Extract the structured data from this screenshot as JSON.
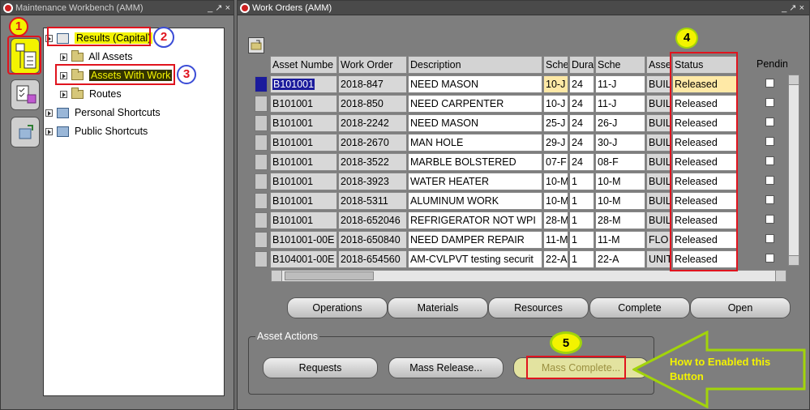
{
  "left_window": {
    "title": "Maintenance Workbench (AMM)",
    "controls": "_ ↗ ×"
  },
  "right_window": {
    "title": "Work Orders (AMM)",
    "controls": "_ ↗ ×"
  },
  "tree": {
    "results": "Results (Capital)",
    "all_assets": "All Assets",
    "assets_with_work": "Assets With Work",
    "routes": "Routes",
    "personal_shortcuts": "Personal Shortcuts",
    "public_shortcuts": "Public Shortcuts"
  },
  "grid": {
    "headers": [
      "Asset Numbe",
      "Work Order",
      "Description",
      "Sche",
      "Dura",
      "Sche",
      "Asse",
      "Status",
      "Pendin"
    ],
    "rows": [
      [
        "B101001",
        "2018-847",
        "NEED MASON",
        "10-J",
        "24",
        "11-J",
        "BUIL",
        "Released"
      ],
      [
        "B101001",
        "2018-850",
        "NEED CARPENTER",
        "10-J",
        "24",
        "11-J",
        "BUIL",
        "Released"
      ],
      [
        "B101001",
        "2018-2242",
        "NEED MASON",
        "25-J",
        "24",
        "26-J",
        "BUIL",
        "Released"
      ],
      [
        "B101001",
        "2018-2670",
        "MAN HOLE",
        "29-J",
        "24",
        "30-J",
        "BUIL",
        "Released"
      ],
      [
        "B101001",
        "2018-3522",
        "MARBLE BOLSTERED",
        "07-F",
        "24",
        "08-F",
        "BUIL",
        "Released"
      ],
      [
        "B101001",
        "2018-3923",
        "WATER HEATER",
        "10-M",
        "1",
        "10-M",
        "BUIL",
        "Released"
      ],
      [
        "B101001",
        "2018-5311",
        "ALUMINUM WORK",
        "10-M",
        "1",
        "10-M",
        "BUIL",
        "Released"
      ],
      [
        "B101001",
        "2018-652046",
        "REFRIGERATOR NOT WPI",
        "28-M",
        "1",
        "28-M",
        "BUIL",
        "Released"
      ],
      [
        "B101001-00E",
        "2018-650840",
        "NEED DAMPER REPAIR",
        "11-M",
        "1",
        "11-M",
        "FLO",
        "Released"
      ],
      [
        "B104001-00E",
        "2018-654560",
        "AM-CVLPVT testing securit",
        "22-A",
        "1",
        "22-A",
        "UNIT",
        "Released"
      ]
    ]
  },
  "tab_buttons": {
    "operations": "Operations",
    "materials": "Materials",
    "resources": "Resources",
    "complete": "Complete",
    "open": "Open"
  },
  "asset_actions": {
    "label": "Asset Actions",
    "requests": "Requests",
    "mass_release": "Mass Release...",
    "mass_complete": "Mass Complete..."
  },
  "annotations": {
    "b1": "1",
    "b2": "2",
    "b3": "3",
    "b4": "4",
    "b5": "5",
    "callout": "How to Enabled this Button"
  },
  "colors": {
    "highlight_yellow": "#f3f300",
    "annotation_red": "#e0141e",
    "callout_green": "#a2d40a",
    "callout_text": "#f3f300"
  }
}
